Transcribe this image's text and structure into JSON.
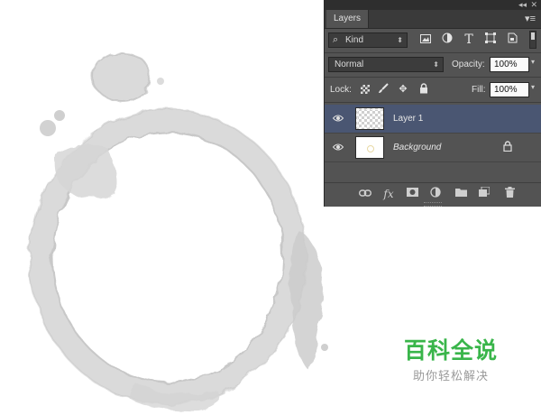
{
  "panel": {
    "tab_label": "Layers",
    "collapse_glyph": "◂◂",
    "close_glyph": "✕",
    "menu_glyph": "▾≡"
  },
  "filter": {
    "kind_value": "Kind",
    "kind_icon": "magnifier-icon",
    "icons": [
      "image-filter-icon",
      "adjustment-filter-icon",
      "type-filter-icon",
      "shape-filter-icon",
      "smart-object-filter-icon"
    ]
  },
  "blend": {
    "mode_value": "Normal",
    "opacity_label": "Opacity:",
    "opacity_value": "100%"
  },
  "lock": {
    "label": "Lock:",
    "fill_label": "Fill:",
    "fill_value": "100%"
  },
  "layers": [
    {
      "name": "Layer 1",
      "selected": true,
      "visible": true,
      "thumb": "transparent"
    },
    {
      "name": "Background",
      "selected": false,
      "visible": true,
      "thumb": "white",
      "locked": true
    }
  ],
  "footer_icons": [
    "link-icon",
    "fx-icon",
    "mask-icon",
    "adjustment-icon",
    "folder-icon",
    "new-layer-icon",
    "trash-icon"
  ],
  "footer": {
    "fx_label": "fx"
  },
  "watermark": {
    "title": "百科全说",
    "subtitle": "助你轻松解决"
  },
  "colors": {
    "panel_bg": "#535353",
    "selected_row": "#4a5672",
    "watermark_green": "#39b54a",
    "stain_gray": "#d2d2d2"
  }
}
